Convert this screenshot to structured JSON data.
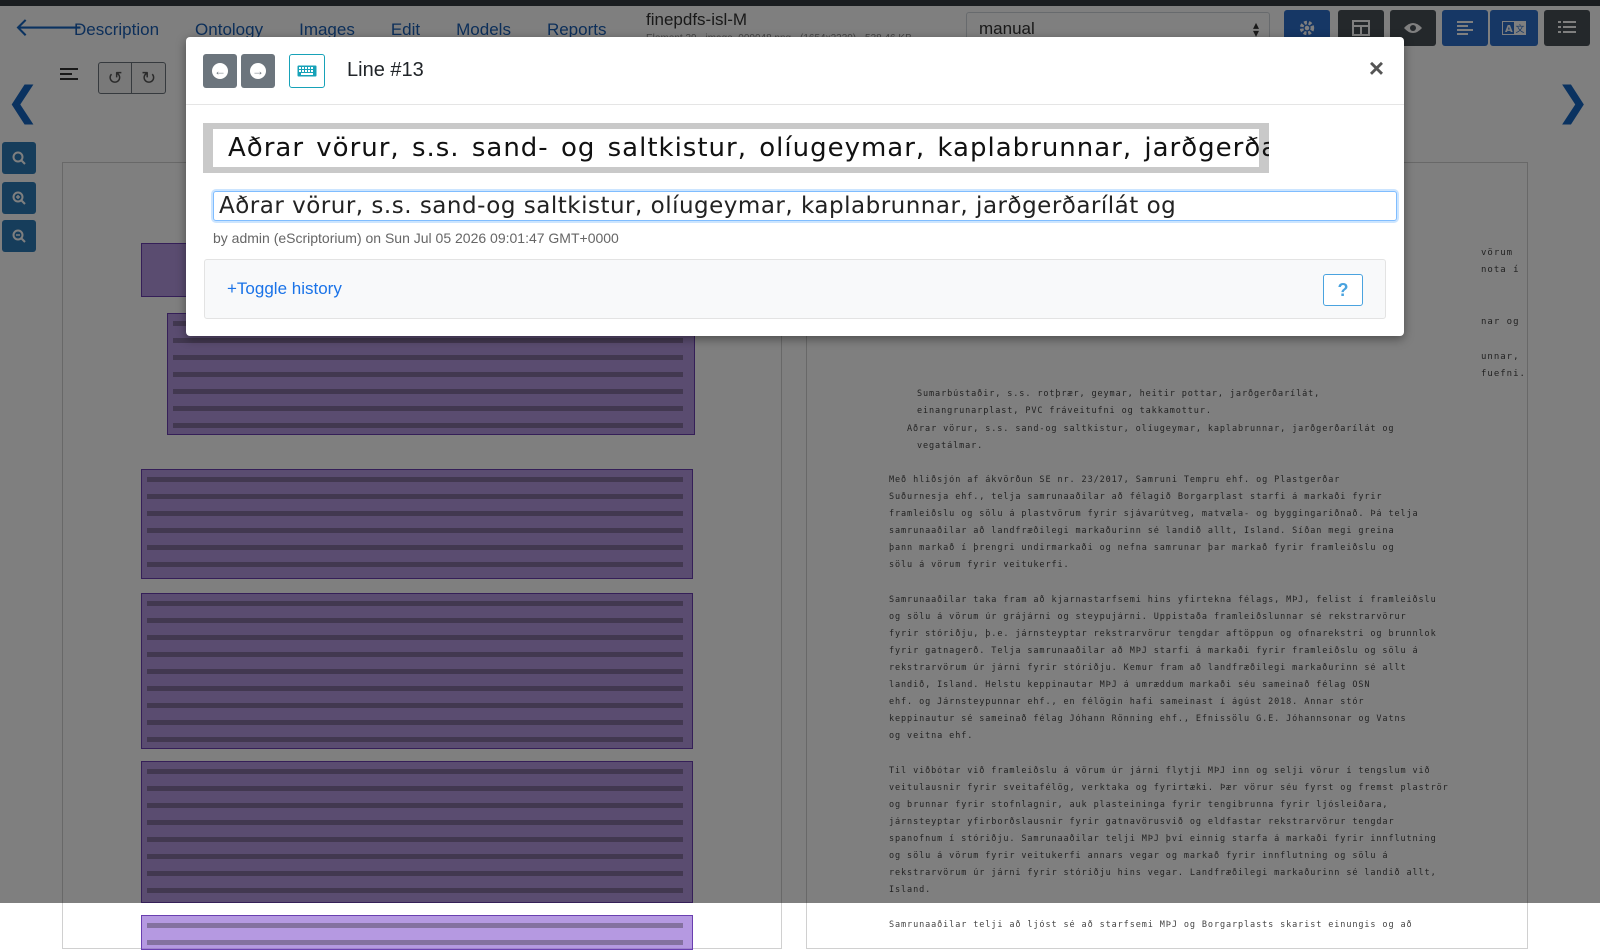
{
  "nav": {
    "links": [
      "Description",
      "Ontology",
      "Images",
      "Edit",
      "Models",
      "Reports"
    ],
    "doc_title": "finepdfs-isl-M",
    "doc_subtitle": "Element 39 - image_000048.png - (1654x2339) - 538.46 KB",
    "transcription_select": "manual"
  },
  "toolbar_icons": [
    "settings-icon",
    "table-icon",
    "eye-icon",
    "align-left-icon",
    "translate-icon",
    "list-icon"
  ],
  "modal": {
    "title": "Line #13",
    "line_image_text": "Aðrar vörur, s.s. sand- og saltkistur, olíugeymar, kaplabrunnar, jarðgerðarílát og",
    "transcription_value": "Aðrar vörur, s.s. sand-og saltkistur, olíugeymar, kaplabrunnar, jarðgerðarílát og",
    "byline": "by admin (eScriptorium) on Sun Jul 05 2026 09:01:47 GMT+0000",
    "toggle_history": "+Toggle history",
    "help_label": "?"
  },
  "right_panel_lines": [
    "Sumarbústaðir, s.s. rotþrær, geymar, heitir pottar, jarðgerðarílát,",
    "einangrunarplast, PVC fráveitufni og takkamottur.",
    "Aðrar vörur, s.s. sand-og saltkistur, olíugeymar, kaplabrunnar, jarðgerðarílát og",
    "vegatálmar.",
    "Með hliðsjón af ákvörðun SE nr. 23/2017, Samruni Tempru ehf. og Plastgerðar",
    "Suðurnesja ehf., telja samrunaaðilar að félagið Borgarplast starfi á markaði fyrir",
    "framleiðslu og sölu á plastvörum fyrir sjávarútveg, matvæla- og byggingariðnað. Þá telja",
    "samrunaaðilar að landfræðilegi markaðurinn sé landið allt, Ísland. Síðan megi greina",
    "þann markað í þrengri undirmarkaði og nefna samrunar þar markað fyrir framleiðslu og",
    "sölu á vörum fyrir veitukerfi.",
    "Samrunaaðilar taka fram að kjarnastarfsemi hins yfirtekna félags, MÞJ, felist í framleiðslu",
    "og sölu á vörum úr grájárni og steypujárni. Uppistaða framleiðslunnar sé rekstrarvörur",
    "fyrir stóriðju, þ.e. járnsteyptar rekstrarvörur tengdar aftöppun og ofnarekstri og brunnlok",
    "fyrir gatnagerð. Telja samrunaaðilar að MÞJ starfi á markaði fyrir framleiðslu og sölu á",
    "rekstrarvörum úr járni fyrir stóriðju. Kemur fram að landfræðilegi markaðurinn sé allt",
    "landið, Ísland. Helstu keppinautar MÞJ á umræddum markaði séu sameinað félag OSN",
    "ehf. og Járnsteypunnar ehf., en félögin hafi sameinast í ágúst 2018. Annar stór",
    "keppinautur sé sameinað félag Jóhann Rönning ehf., Efnissölu G.E. Jóhannsonar og Vatns",
    "og veitna ehf.",
    "Til viðbótar við framleiðslu á vörum úr járni flytji MÞJ inn og selji vörur í tengslum við",
    "veitulausnir fyrir sveitafélög, verktaka og fyrirtæki. Þær vörur séu fyrst og fremst plaströr",
    "og brunnar fyrir stofnlagnir, auk plasteininga fyrir tengibrunna fyrir ljósleiðara,",
    "járnsteyptar yfirborðslausnir fyrir gatnavörusvið og eldfastar rekstrarvörur tengdar",
    "spanofnum í stóriðju. Samrunaaðilar telji MÞJ því einnig starfa á markaði fyrir innflutning",
    "og sölu á vörum fyrir veitukerfi annars vegar og markað fyrir innflutning og sölu á",
    "rekstrarvörum úr járni fyrir stóriðju hins vegar. Landfræðilegi markaðurinn sé landið allt,",
    "Ísland.",
    "Samrunaaðilar telji að ljóst sé að starfsemi MÞJ og Borgarplasts skarist einungis og að"
  ],
  "right_panel_top_lines": [
    "vörum",
    "nota í",
    "nar og",
    "unnar,",
    "fuefni."
  ],
  "colors": {
    "nav_link": "#1a5fb4",
    "toolbar_primary": "#2c6ecb",
    "toolbar_dark": "#495057",
    "segment_fill": "#7846c8",
    "overlay": "rgba(0,0,0,0.5)"
  }
}
